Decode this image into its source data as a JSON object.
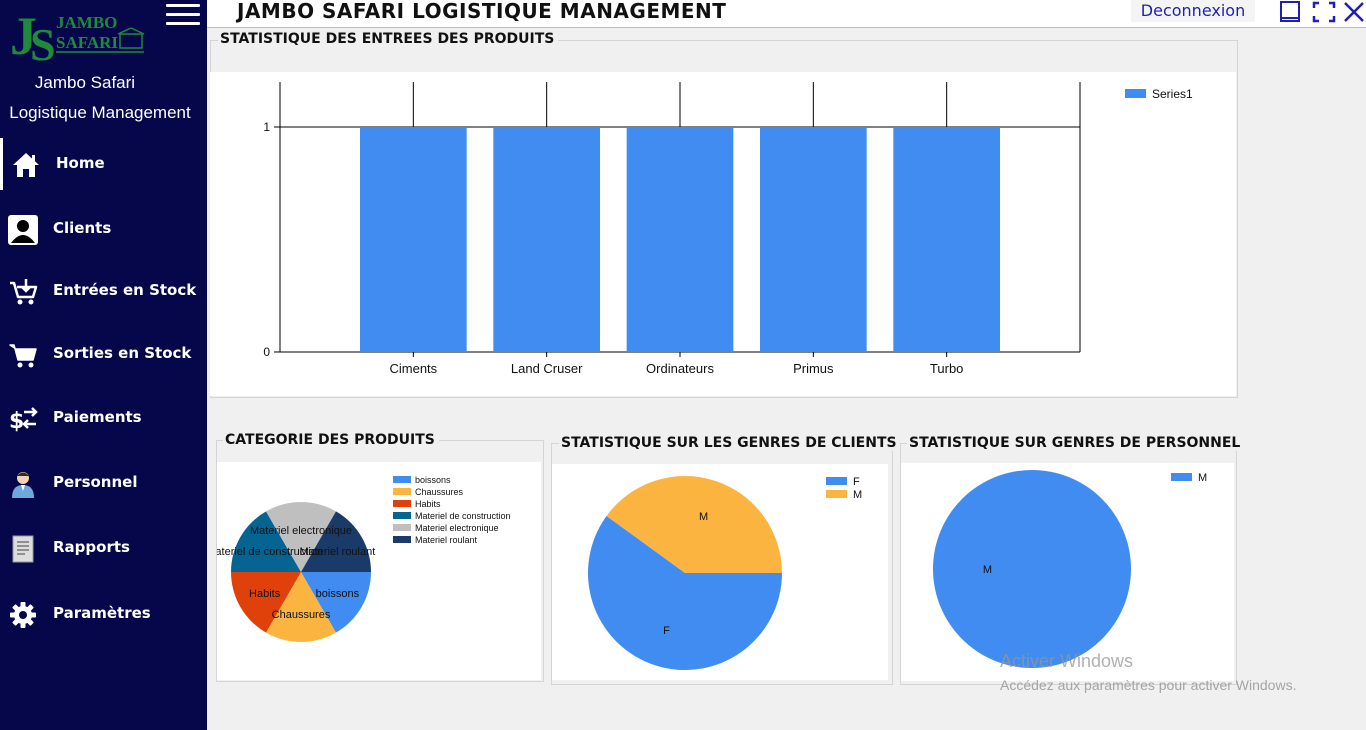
{
  "app": {
    "title": "JAMBO SAFARI LOGISTIQUE MANAGEMENT",
    "logout_label": "Deconnexion"
  },
  "logo": {
    "initials": "JS",
    "line1": "JAMBO",
    "line2": "SAFARI"
  },
  "sidebar": {
    "brand_line1": "Jambo Safari",
    "brand_line2": "Logistique Management",
    "items": [
      {
        "label": "Home",
        "icon": "home-icon"
      },
      {
        "label": "Clients",
        "icon": "user-icon"
      },
      {
        "label": "Entrées en Stock",
        "icon": "cart-in-icon"
      },
      {
        "label": "Sorties en Stock",
        "icon": "cart-icon"
      },
      {
        "label": "Paiements",
        "icon": "payment-icon"
      },
      {
        "label": "Personnel",
        "icon": "staff-icon"
      },
      {
        "label": "Rapports",
        "icon": "report-icon"
      },
      {
        "label": "Paramètres",
        "icon": "gear-icon"
      }
    ]
  },
  "sections": {
    "products_title": "STATISTIQUE DES ENTREES DES PRODUITS",
    "category_title": "CATEGORIE DES PRODUITS",
    "clients_title": "STATISTIQUE SUR LES GENRES DE CLIENTS",
    "staff_title": "STATISTIQUE SUR  GENRES DE PERSONNEL"
  },
  "colors": {
    "sidebar_bg": "#06064a",
    "blue": "#418cf0",
    "yellow": "#fcb441",
    "red": "#e0400a",
    "teal": "#056492",
    "grey": "#bfbfbf",
    "navy": "#1a3b69"
  },
  "chart_data": [
    {
      "type": "bar",
      "categories": [
        "Ciments",
        "Land Cruser",
        "Ordinateurs",
        "Primus",
        "Turbo"
      ],
      "series": [
        {
          "name": "Series1",
          "values": [
            1,
            1,
            1,
            1,
            1
          ]
        }
      ],
      "yticks": [
        "0",
        "1"
      ],
      "ylim": [
        0,
        1.2
      ],
      "legend": "top-right"
    },
    {
      "type": "pie",
      "labels": [
        "boissons",
        "Chaussures",
        "Habits",
        "Materiel de construction",
        "Materiel electronique",
        "Materiel roulant"
      ],
      "values": [
        1,
        1,
        1,
        1,
        1,
        1
      ],
      "legend": "right"
    },
    {
      "type": "pie",
      "labels": [
        "F",
        "M"
      ],
      "values": [
        3,
        2
      ],
      "legend": "top-right"
    },
    {
      "type": "pie",
      "labels": [
        "M"
      ],
      "values": [
        1
      ],
      "legend": "top-right"
    }
  ],
  "watermark": {
    "title": "Activer Windows",
    "subtitle": "Accédez aux paramètres pour activer Windows."
  }
}
